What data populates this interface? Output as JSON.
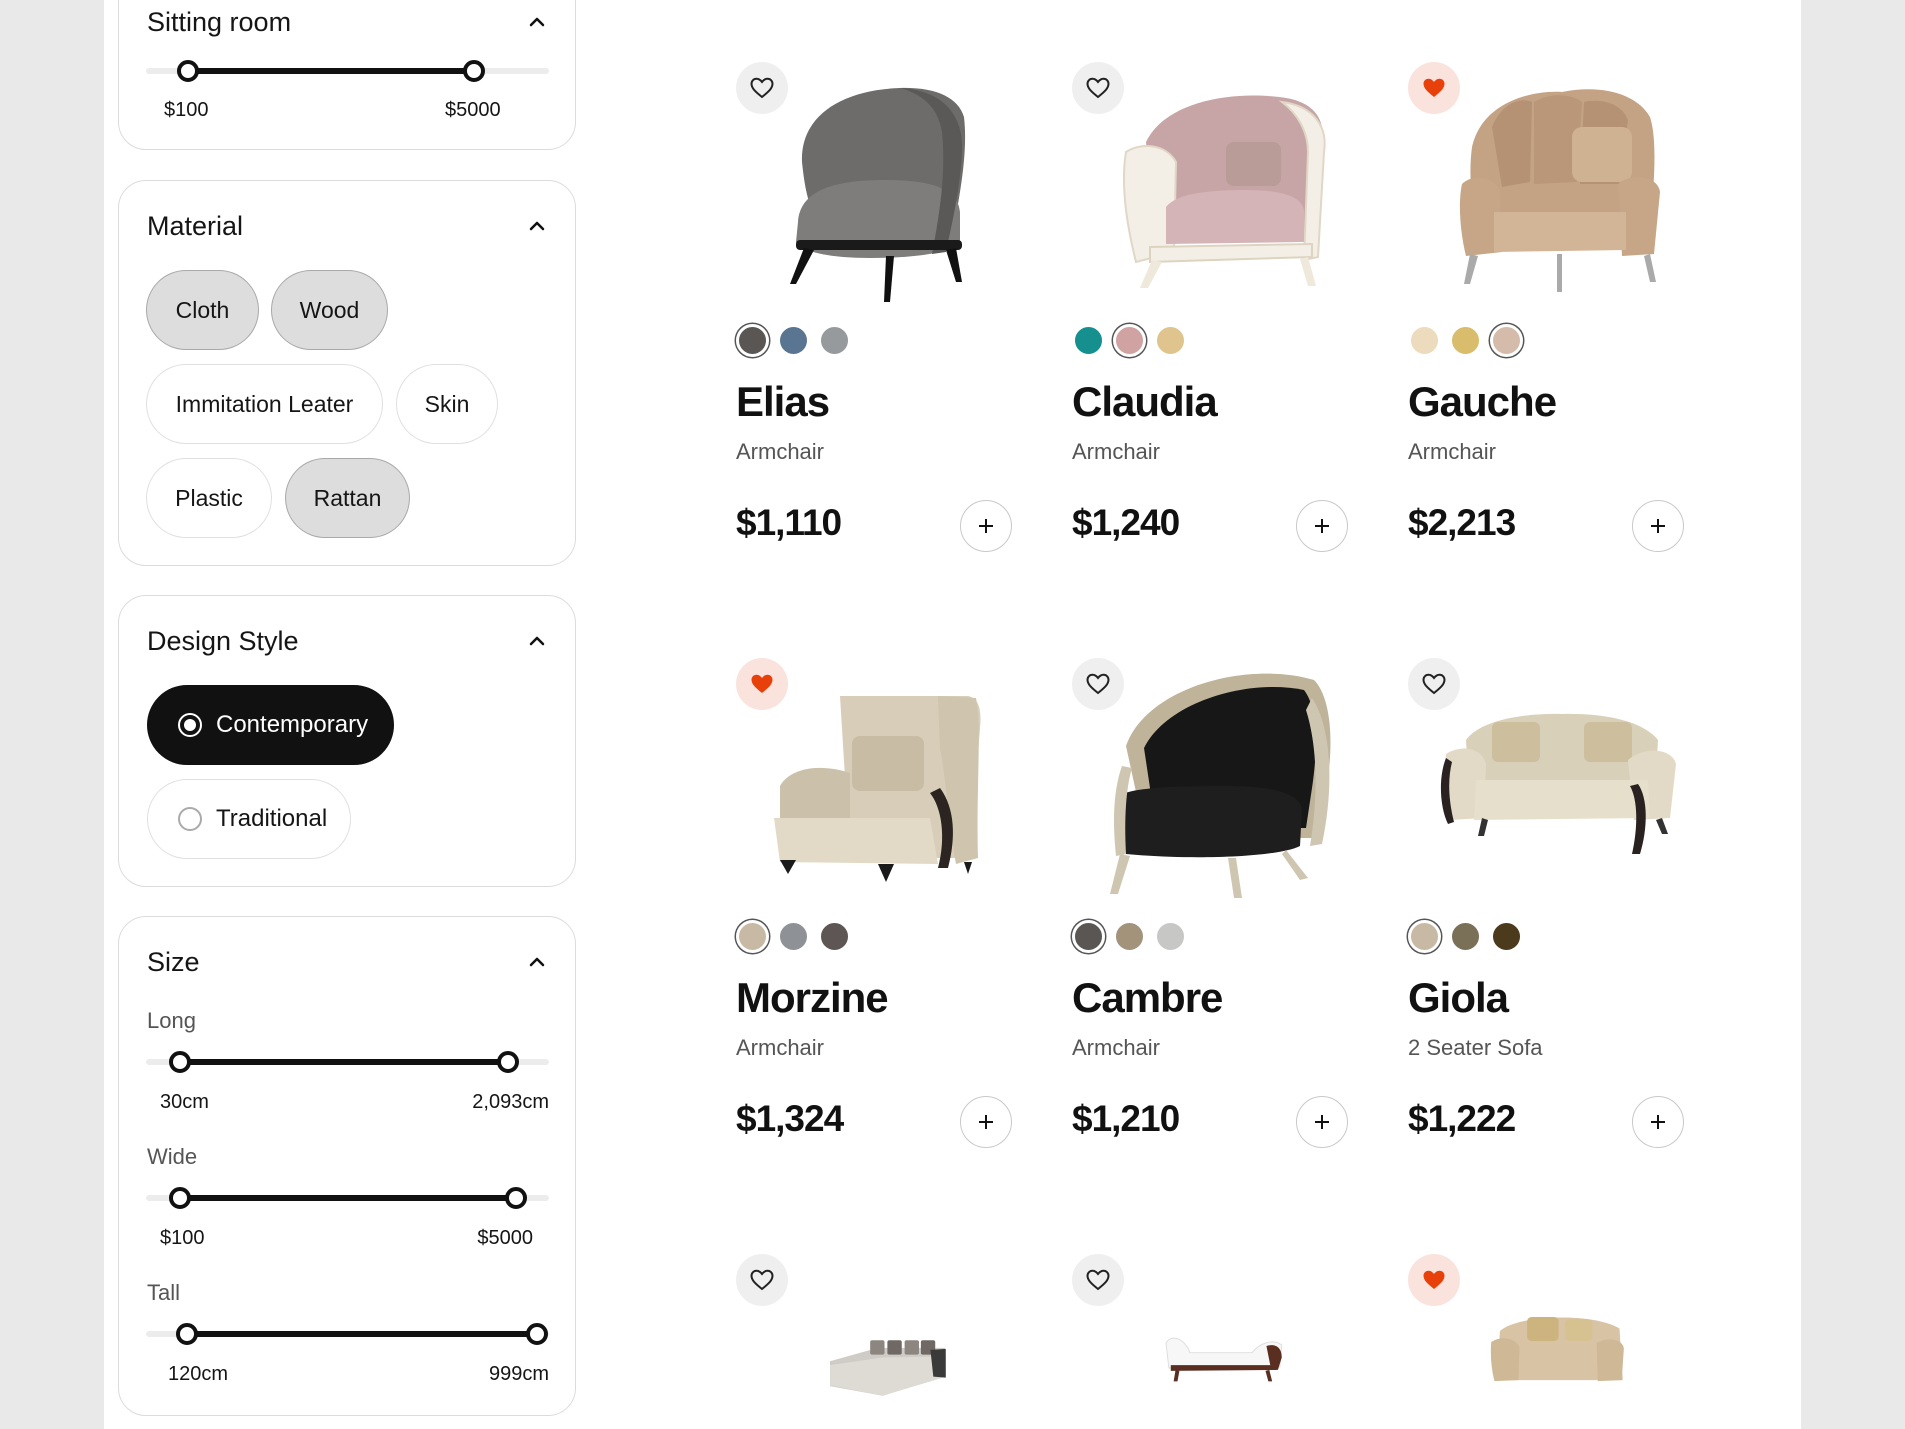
{
  "filters": {
    "sitting_room": {
      "title": "Sitting room",
      "min_label": "$100",
      "max_label": "$5000"
    },
    "material": {
      "title": "Material",
      "options": [
        {
          "label": "Cloth",
          "selected": true
        },
        {
          "label": "Wood",
          "selected": true
        },
        {
          "label": "Immitation Leater",
          "selected": false
        },
        {
          "label": "Skin",
          "selected": false
        },
        {
          "label": "Plastic",
          "selected": false
        },
        {
          "label": "Rattan",
          "selected": true
        }
      ]
    },
    "design_style": {
      "title": "Design Style",
      "options": [
        {
          "label": "Contemporary",
          "selected": true
        },
        {
          "label": "Traditional",
          "selected": false
        }
      ]
    },
    "size": {
      "title": "Size",
      "long": {
        "label": "Long",
        "min_label": "30cm",
        "max_label": "2,093cm"
      },
      "wide": {
        "label": "Wide",
        "min_label": "$100",
        "max_label": "$5000"
      },
      "tall": {
        "label": "Tall",
        "min_label": "120cm",
        "max_label": "999cm"
      }
    }
  },
  "products": [
    {
      "name": "Elias",
      "type": "Armchair",
      "price": "$1,110",
      "favorite": false,
      "swatches": [
        "#5a5654",
        "#5a7591",
        "#969a9d"
      ],
      "selected_swatch": 0,
      "icon": "armchair-grey"
    },
    {
      "name": "Claudia",
      "type": "Armchair",
      "price": "$1,240",
      "favorite": false,
      "swatches": [
        "#15908f",
        "#d0a2a1",
        "#dfc58d"
      ],
      "selected_swatch": 1,
      "icon": "armchair-pink"
    },
    {
      "name": "Gauche",
      "type": "Armchair",
      "price": "$2,213",
      "favorite": true,
      "swatches": [
        "#ecdcbd",
        "#d9bd6c",
        "#d5bcaa"
      ],
      "selected_swatch": 2,
      "icon": "armchair-beige"
    },
    {
      "name": "Morzine",
      "type": "Armchair",
      "price": "$1,324",
      "favorite": true,
      "swatches": [
        "#c8b9a4",
        "#8e9297",
        "#5d5654"
      ],
      "selected_swatch": 0,
      "icon": "armchair-cream"
    },
    {
      "name": "Cambre",
      "type": "Armchair",
      "price": "$1,210",
      "favorite": false,
      "swatches": [
        "#5a5654",
        "#a2937a",
        "#c7c7c6"
      ],
      "selected_swatch": 0,
      "icon": "armchair-black"
    },
    {
      "name": "Giola",
      "type": "2 Seater Sofa",
      "price": "$1,222",
      "favorite": false,
      "swatches": [
        "#c8b9a4",
        "#7a7058",
        "#4b3a1b"
      ],
      "selected_swatch": 0,
      "icon": "sofa-cream"
    },
    {
      "name": "",
      "type": "",
      "price": "",
      "favorite": false,
      "swatches": [],
      "icon": "sectional-sofa"
    },
    {
      "name": "",
      "type": "",
      "price": "",
      "favorite": false,
      "swatches": [],
      "icon": "chaise-white"
    },
    {
      "name": "",
      "type": "",
      "price": "",
      "favorite": true,
      "swatches": [],
      "icon": "sofa-rattan"
    }
  ],
  "colors": {
    "favorite_on": "#e8400b",
    "accent": "#111111"
  }
}
